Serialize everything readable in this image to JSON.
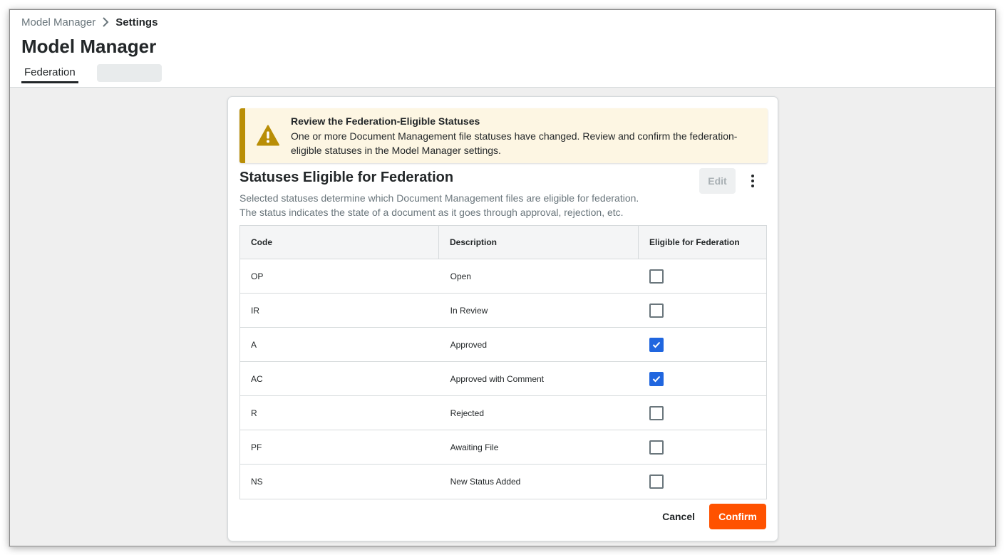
{
  "breadcrumb": {
    "parent": "Model Manager",
    "current": "Settings"
  },
  "page_title": "Model Manager",
  "tabs": [
    {
      "label": "Federation",
      "active": true
    }
  ],
  "banner": {
    "icon": "warning-icon",
    "title": "Review the Federation-Eligible Statuses",
    "text": "One or more Document Management file statuses have changed. Review and confirm the federation-eligible statuses in the Model Manager settings."
  },
  "section": {
    "title": "Statuses Eligible for Federation",
    "description_line1": "Selected statuses determine which Document Management files are eligible for federation.",
    "description_line2": "The status indicates the state of a document as it goes through approval, rejection, etc.",
    "edit_label": "Edit",
    "more_icon": "more-vertical-icon"
  },
  "table": {
    "columns": [
      "Code",
      "Description",
      "Eligible for Federation"
    ],
    "rows": [
      {
        "code": "OP",
        "description": "Open",
        "eligible": false
      },
      {
        "code": "IR",
        "description": "In Review",
        "eligible": false
      },
      {
        "code": "A",
        "description": "Approved",
        "eligible": true
      },
      {
        "code": "AC",
        "description": "Approved with Comment",
        "eligible": true
      },
      {
        "code": "R",
        "description": "Rejected",
        "eligible": false
      },
      {
        "code": "PF",
        "description": "Awaiting File",
        "eligible": false
      },
      {
        "code": "NS",
        "description": "New Status Added",
        "eligible": false
      }
    ]
  },
  "footer": {
    "cancel_label": "Cancel",
    "confirm_label": "Confirm"
  },
  "colors": {
    "accent": "#ff5200",
    "checkbox_checked": "#2066df",
    "warning": "#b98e06",
    "warning_bg": "#fdf6e3"
  }
}
